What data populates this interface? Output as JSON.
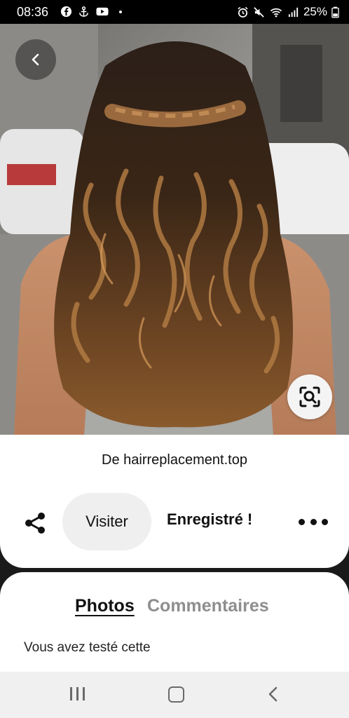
{
  "status_bar": {
    "time": "08:36",
    "battery": "25%"
  },
  "pin": {
    "source_prefix": "De ",
    "source_domain": "hairreplacement.top",
    "visit_label": "Visiter",
    "saved_label": "Enregistré !"
  },
  "tabs": {
    "photos": "Photos",
    "comments": "Commentaires"
  },
  "comment_prompt": "Vous avez testé cette",
  "colors": {
    "card_bg": "#ffffff",
    "visit_bg": "#efefef",
    "inactive_tab": "#8e8e8e"
  }
}
